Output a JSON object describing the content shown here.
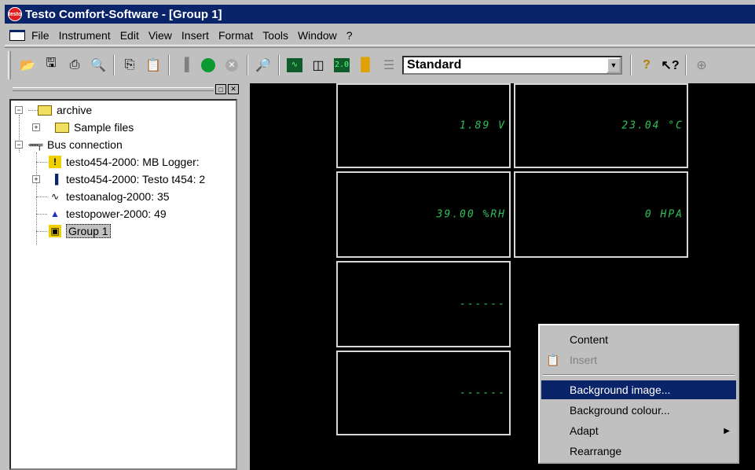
{
  "window": {
    "title": "Testo Comfort-Software - [Group 1]"
  },
  "menubar": {
    "items": [
      {
        "label": "File"
      },
      {
        "label": "Instrument"
      },
      {
        "label": "Edit"
      },
      {
        "label": "View"
      },
      {
        "label": "Insert"
      },
      {
        "label": "Format"
      },
      {
        "label": "Tools"
      },
      {
        "label": "Window"
      },
      {
        "label": "?"
      }
    ]
  },
  "toolbar": {
    "view_combo_value": "Standard",
    "icons": [
      "open-icon",
      "save-icon",
      "print-icon",
      "print-preview-icon",
      "copy-icon",
      "paste-icon",
      "instrument-icon",
      "record-icon",
      "stop-icon",
      "find-icon",
      "graph-icon",
      "table-icon",
      "digital-display-icon",
      "bar-chart-icon",
      "list-icon",
      "help-icon",
      "context-help-icon"
    ],
    "digital_icon_text": "2.0"
  },
  "tree": {
    "nodes": [
      {
        "label": "archive"
      },
      {
        "label": "Sample files"
      },
      {
        "label": "Bus connection"
      },
      {
        "label": "testo454-2000: MB Logger: "
      },
      {
        "label": "testo454-2000: Testo t454: 2"
      },
      {
        "label": "testoanalog-2000: 35"
      },
      {
        "label": "testopower-2000: 49"
      },
      {
        "label": "Group 1"
      }
    ]
  },
  "display": {
    "panels": [
      {
        "value": "1.89 V"
      },
      {
        "value": "23.04 °C"
      },
      {
        "value": "39.00 %RH"
      },
      {
        "value": "0 HPA"
      },
      {
        "value": "------"
      },
      {
        "value": "------"
      }
    ]
  },
  "context_menu": {
    "items": [
      {
        "label": "Content"
      },
      {
        "label": "Insert"
      },
      {
        "label": "Background image..."
      },
      {
        "label": "Background colour..."
      },
      {
        "label": "Adapt"
      },
      {
        "label": "Rearrange"
      }
    ]
  }
}
